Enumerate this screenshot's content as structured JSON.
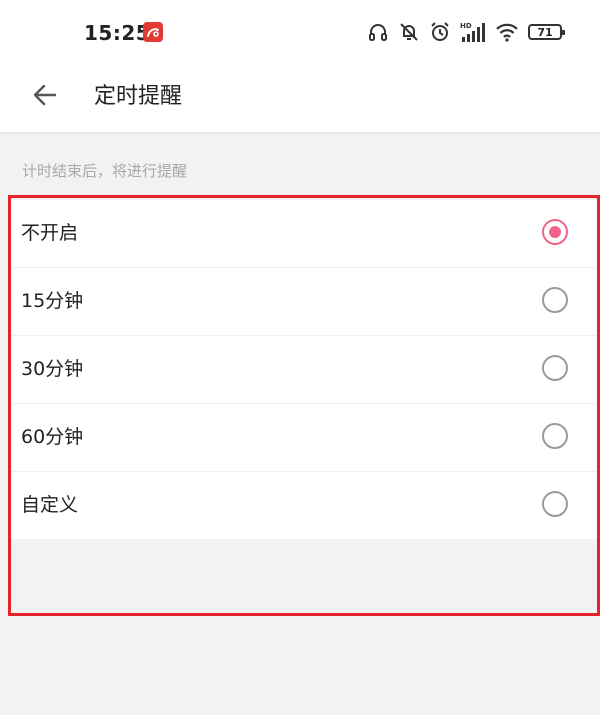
{
  "status_bar": {
    "time": "15:25",
    "app_badge_icon": "red-app-badge-icon",
    "icons": [
      "headset-icon",
      "bell-muted-icon",
      "alarm-icon",
      "hd-signal-icon",
      "wifi-icon"
    ],
    "battery": "71"
  },
  "header": {
    "back_icon": "arrow-left-icon",
    "title": "定时提醒"
  },
  "hint": "计时结束后，将进行提醒",
  "options": [
    {
      "label": "不开启",
      "selected": true
    },
    {
      "label": "15分钟",
      "selected": false
    },
    {
      "label": "30分钟",
      "selected": false
    },
    {
      "label": "60分钟",
      "selected": false
    },
    {
      "label": "自定义",
      "selected": false
    }
  ],
  "colors": {
    "accent": "#f06587",
    "highlight_border": "#e5242a",
    "background": "#f2f2f2"
  }
}
